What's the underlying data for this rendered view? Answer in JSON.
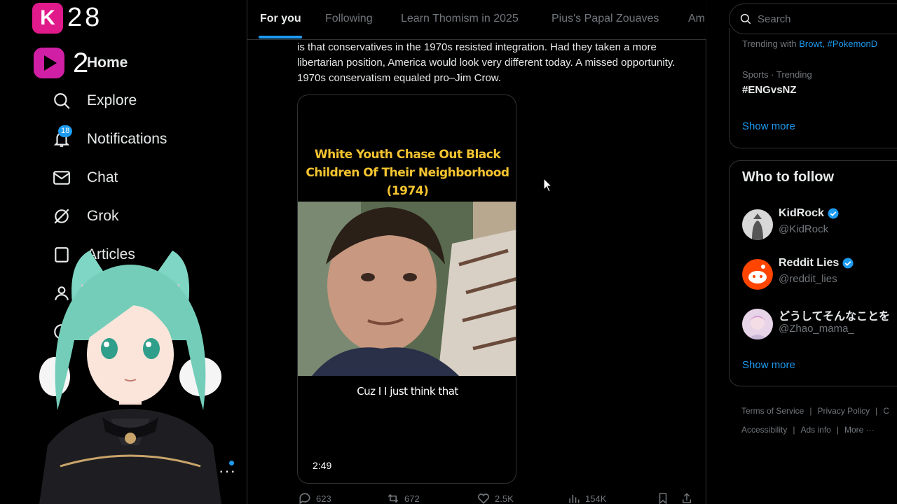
{
  "logos": {
    "k_letter": "K",
    "k_number": "28",
    "p_number": "2"
  },
  "nav": {
    "home": "Home",
    "explore": "Explore",
    "notifications": "Notifications",
    "notifications_badge": "18",
    "chat": "Chat",
    "grok": "Grok",
    "articles": "Articles"
  },
  "tabs": [
    "For you",
    "Following",
    "Learn Thomism in 2025",
    "Pius's Papal Zouaves",
    "Am"
  ],
  "tweet": {
    "text": "is that conservatives in the 1970s resisted integration. Had they taken a more libertarian position, America would look very different today. A missed opportunity. 1970s conservatism equaled pro–Jim Crow.",
    "media": {
      "title_line1": "White Youth Chase Out Black",
      "title_line2": "Children Of Their Neighborhood",
      "title_line3": "(1974)",
      "subtitle": "Cuz I I just think that",
      "duration": "2:49"
    },
    "actions": {
      "replies": "623",
      "reposts": "672",
      "likes": "2.5K",
      "views": "154K"
    }
  },
  "search": {
    "placeholder": "Search"
  },
  "trends": {
    "trending_with_label": "Trending with",
    "trending_with_links": "Browt, #PokemonD",
    "item_meta": "Sports · Trending",
    "item_title": "#ENGvsNZ",
    "show_more": "Show more"
  },
  "who_to_follow": {
    "title": "Who to follow",
    "accounts": [
      {
        "name": "KidRock",
        "handle": "@KidRock",
        "verified": true
      },
      {
        "name": "Reddit Lies",
        "handle": "@reddit_lies",
        "verified": true
      },
      {
        "name": "どうしてそんなことを",
        "handle": "@Zhao_mama_",
        "verified": false
      }
    ],
    "show_more": "Show more"
  },
  "footer": {
    "terms": "Terms of Service",
    "privacy": "Privacy Policy",
    "cookie": "C",
    "accessibility": "Accessibility",
    "ads": "Ads info",
    "more": "More ···"
  },
  "colors": {
    "accent": "#1d9bf0",
    "brand_pink": "#e01a8b",
    "media_title": "#f4c430",
    "reddit_orange": "#ff4500"
  }
}
